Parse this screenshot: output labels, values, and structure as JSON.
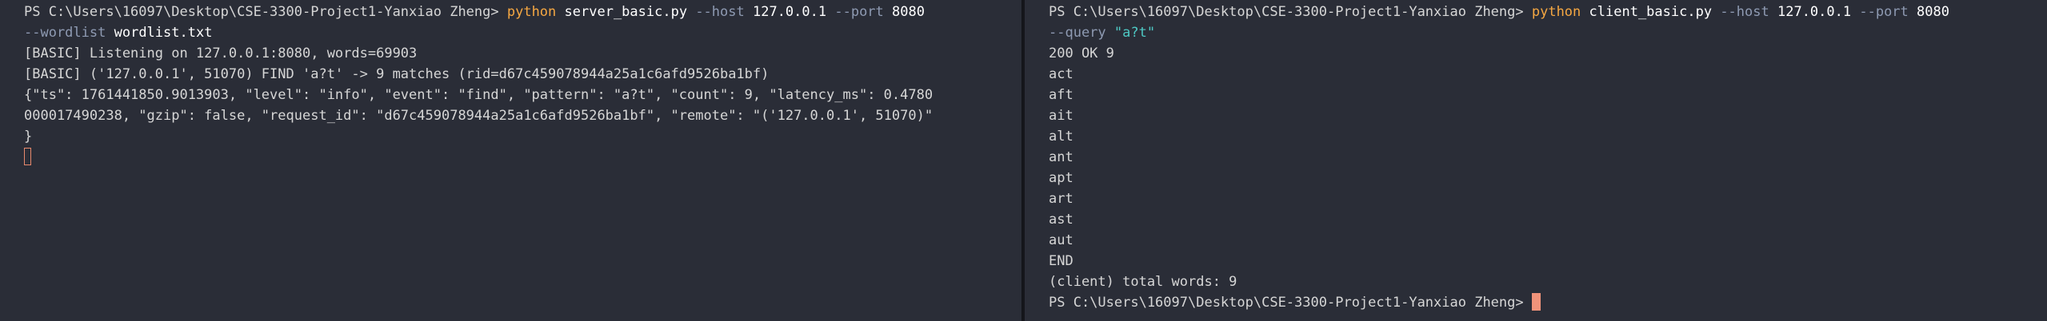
{
  "colors": {
    "background": "#2a2d37",
    "command": "#f5a742",
    "flag": "#8e9ab2",
    "string": "#4ec9c4",
    "cursor": "#f0937a",
    "text": "#d6d6d6"
  },
  "left": {
    "prompt": "PS C:\\Users\\16097\\Desktop\\CSE-3300-Project1-Yanxiao Zheng> ",
    "command": "python",
    "script": "server_basic.py",
    "host_flag": "--host",
    "host": "127.0.0.1",
    "port_flag": "--port",
    "port": "8080",
    "wordlist_flag": "--wordlist",
    "wordlist": "wordlist.txt",
    "output": [
      "[BASIC] Listening on 127.0.0.1:8080, words=69903",
      "[BASIC] ('127.0.0.1', 51070) FIND 'a?t' -> 9 matches (rid=d67c459078944a25a1c6afd9526ba1bf)",
      "{\"ts\": 1761441850.9013903, \"level\": \"info\", \"event\": \"find\", \"pattern\": \"a?t\", \"count\": 9, \"latency_ms\": 0.4780",
      "000017490238, \"gzip\": false, \"request_id\": \"d67c459078944a25a1c6afd9526ba1bf\", \"remote\": \"('127.0.0.1', 51070)\"",
      "}"
    ]
  },
  "right": {
    "prompt": "PS C:\\Users\\16097\\Desktop\\CSE-3300-Project1-Yanxiao Zheng> ",
    "command": "python",
    "script": "client_basic.py",
    "host_flag": "--host",
    "host": "127.0.0.1",
    "port_flag": "--port",
    "port": "8080",
    "query_flag": "--query",
    "query": "\"a?t\"",
    "output": [
      "200 OK 9",
      "act",
      "aft",
      "ait",
      "alt",
      "ant",
      "apt",
      "art",
      "ast",
      "aut",
      "END",
      "(client) total words: 9"
    ],
    "final_prompt": "PS C:\\Users\\16097\\Desktop\\CSE-3300-Project1-Yanxiao Zheng> "
  }
}
